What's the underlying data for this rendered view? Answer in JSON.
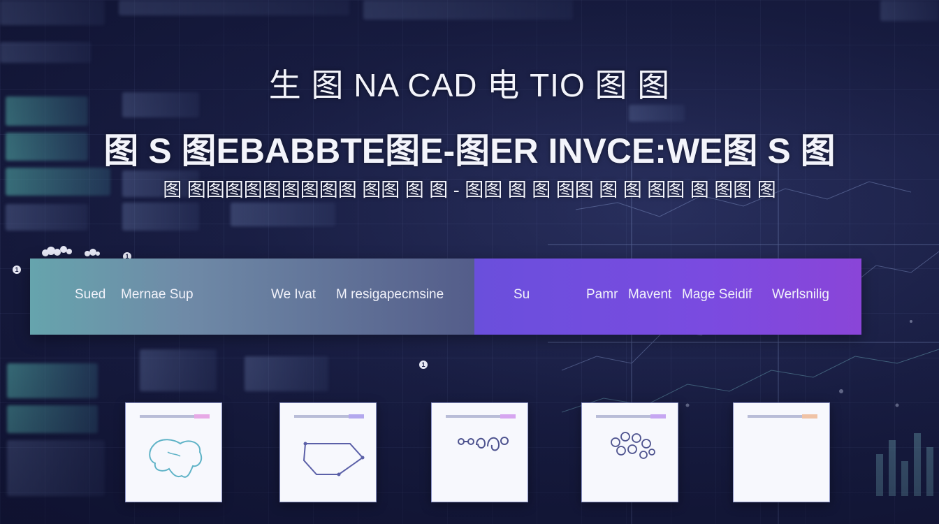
{
  "heading": {
    "line1": "生 图 NA CAD 电 TIO 图 图",
    "line2": "图 S 图EBABBTE图E-图ER INVCE:WE图 S 图",
    "line3": "图 图图图图图图图图图 图图 图 图 - 图图 图 图 图图 图 图 图图 图 图图 图"
  },
  "banner": {
    "left_items": [
      "Sued",
      "Mernae Sup",
      "We Ivat",
      "M resigapecmsine"
    ],
    "right_items": [
      "Su",
      "Pamr",
      "Mavent",
      "Mage Seidif",
      "Werlsnilig"
    ]
  },
  "markers": [
    "1",
    "1",
    "1"
  ],
  "cards": [
    {
      "icon": "map-icon",
      "accent": "#e7a9e6"
    },
    {
      "icon": "shape-icon",
      "accent": "#b3a8ee"
    },
    {
      "icon": "network-icon",
      "accent": "#d6a5f0"
    },
    {
      "icon": "people-icon",
      "accent": "#c6a6f2"
    },
    {
      "icon": "blank-icon",
      "accent": "#f0c3a6"
    }
  ],
  "colors": {
    "banner_left_start": "#66a4ad",
    "banner_left_end": "#545d8a",
    "banner_right_start": "#6a4fdc",
    "banner_right_end": "#8a45d8",
    "background": "#1a1f45"
  }
}
